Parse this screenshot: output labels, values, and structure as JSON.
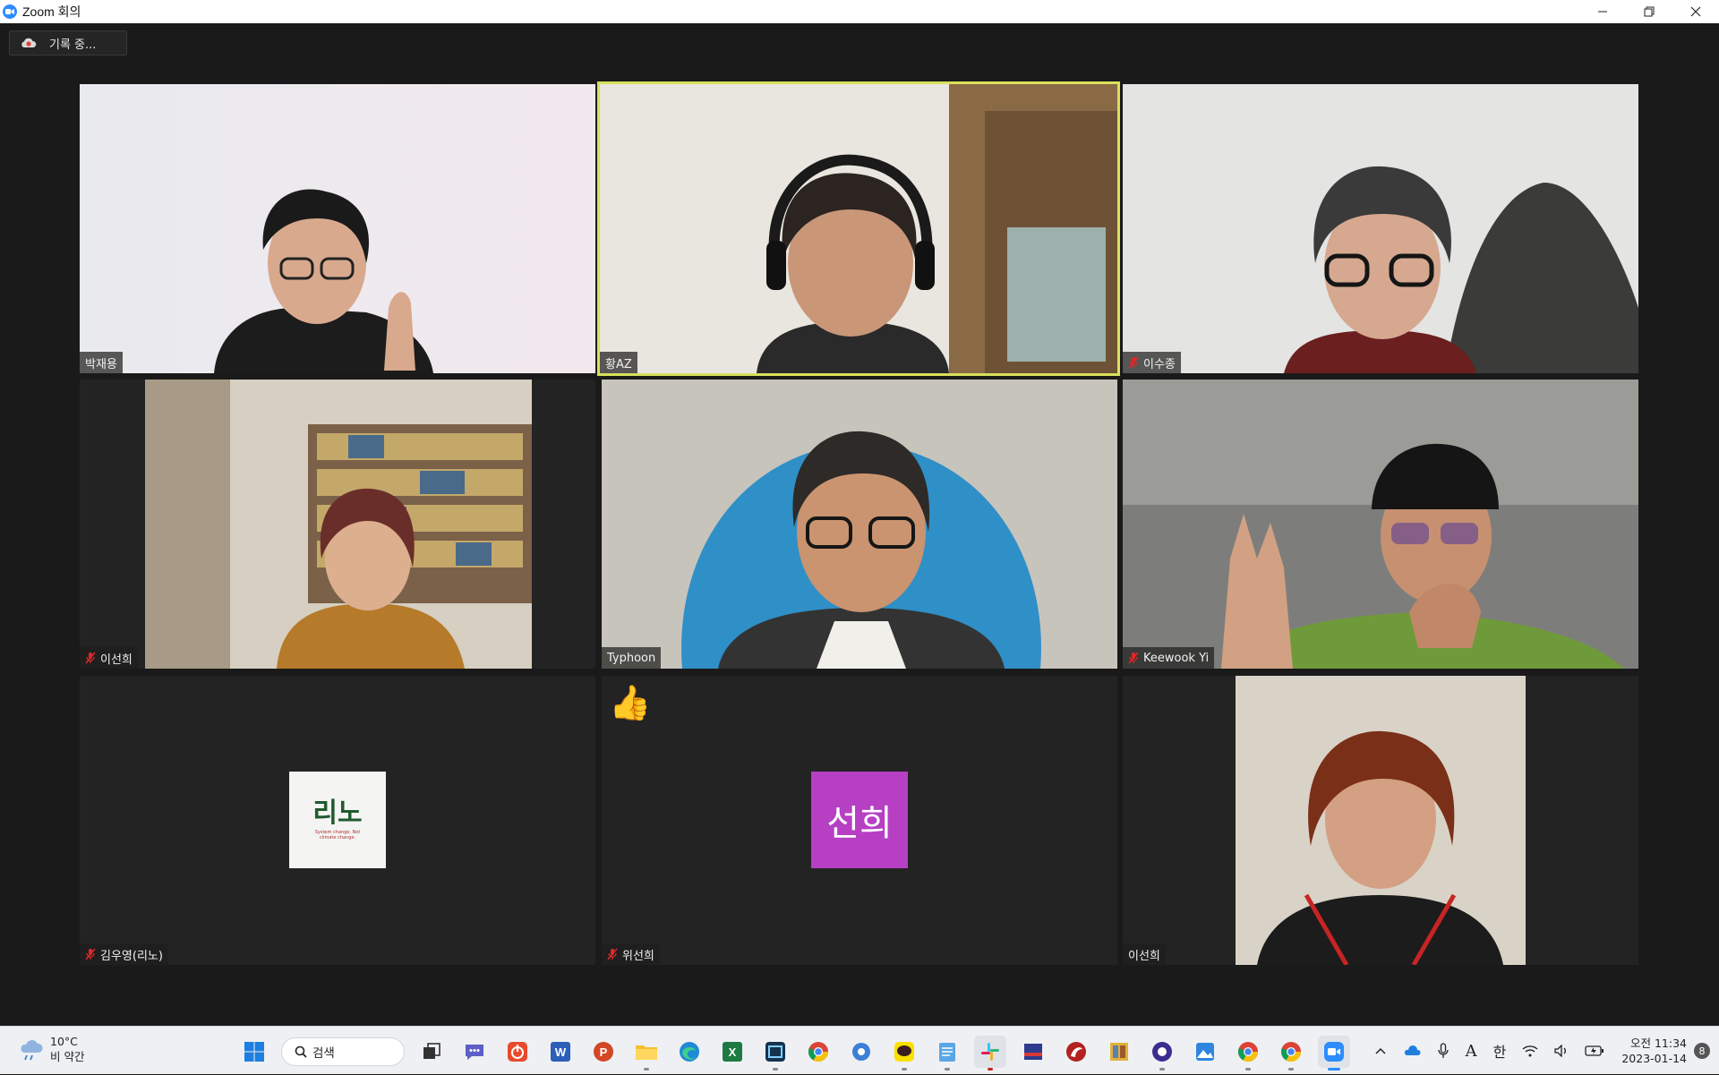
{
  "window": {
    "title": "Zoom 회의"
  },
  "recording": {
    "label": "기록 중..."
  },
  "participants": [
    {
      "name": "박재용",
      "muted": false,
      "active": false,
      "video": true
    },
    {
      "name": "황AZ",
      "muted": false,
      "active": true,
      "video": true
    },
    {
      "name": "이수종",
      "muted": true,
      "active": false,
      "video": true
    },
    {
      "name": "이선희",
      "muted": true,
      "active": false,
      "video": true
    },
    {
      "name": "Typhoon",
      "muted": false,
      "active": false,
      "video": true
    },
    {
      "name": "Keewook Yi",
      "muted": true,
      "active": false,
      "video": true
    },
    {
      "name": "김우영(리노)",
      "muted": true,
      "active": false,
      "video": false,
      "avatar_text": "리노",
      "avatar_subtext": "System change. Not climate change."
    },
    {
      "name": "위선희",
      "muted": true,
      "active": false,
      "video": false,
      "avatar_text": "선희",
      "avatar_color": "#b63fc4",
      "reaction": "👍"
    },
    {
      "name": "이선희",
      "muted": false,
      "active": false,
      "video": true
    }
  ],
  "taskbar": {
    "weather": {
      "temp": "10°C",
      "condition": "비 약간"
    },
    "search_label": "검색",
    "tray_ime": "한",
    "tray_font": "A",
    "clock": {
      "time": "오전 11:34",
      "date": "2023-01-14"
    },
    "notifications": "8"
  },
  "colors": {
    "active_speaker": "#d8e05a",
    "zoom_blue": "#2d8cff",
    "mute_red": "#e02828"
  }
}
